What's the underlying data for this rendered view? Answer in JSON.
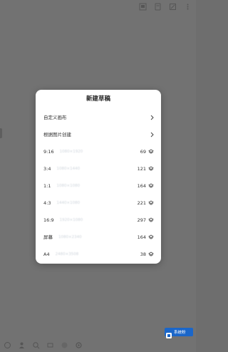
{
  "dialog": {
    "title": "新建草稿",
    "menu": [
      {
        "label": "自定义画布",
        "icon": "chevron-right-icon"
      },
      {
        "label": "根据图片创建",
        "icon": "chevron-right-icon"
      }
    ],
    "presets": [
      {
        "ratio": "9:16",
        "size": "1080×1920",
        "count": "69",
        "icon": "layers-icon"
      },
      {
        "ratio": "3:4",
        "size": "1080×1440",
        "count": "121",
        "icon": "layers-icon"
      },
      {
        "ratio": "1:1",
        "size": "1080×1080",
        "count": "164",
        "icon": "layers-icon"
      },
      {
        "ratio": "4:3",
        "size": "1440×1080",
        "count": "221",
        "icon": "layers-icon"
      },
      {
        "ratio": "16:9",
        "size": "1920×1080",
        "count": "297",
        "icon": "layers-icon"
      },
      {
        "ratio": "屏幕",
        "size": "1080×2340",
        "count": "164",
        "icon": "layers-icon"
      },
      {
        "ratio": "A4",
        "size": "2480×3508",
        "count": "38",
        "icon": "layers-icon"
      }
    ]
  },
  "top_toolbar": [
    "canvas-icon",
    "layers-icon",
    "brush-icon",
    "more-icon"
  ],
  "bottom_toolbar": [
    "undo-icon",
    "person-icon",
    "lasso-icon",
    "eraser-icon",
    "color-icon",
    "settings-icon"
  ],
  "watermark": {
    "text": "系统粉",
    "logo": "watermark-logo-icon"
  }
}
